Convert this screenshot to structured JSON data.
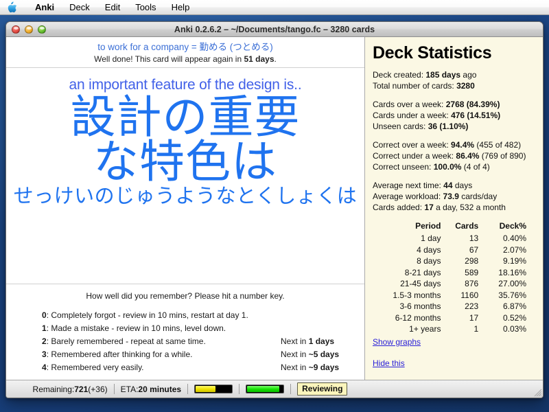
{
  "menubar": {
    "apple_icon": "apple-logo-icon",
    "items": [
      {
        "label": "Anki",
        "bold": true
      },
      {
        "label": "Deck",
        "bold": false
      },
      {
        "label": "Edit",
        "bold": false
      },
      {
        "label": "Tools",
        "bold": false
      },
      {
        "label": "Help",
        "bold": false
      }
    ]
  },
  "window": {
    "title": "Anki 0.2.6.2 – ~/Documents/tango.fc – 3280 cards",
    "controls": {
      "close": "close-button",
      "minimize": "minimize-button",
      "zoom": "zoom-button"
    }
  },
  "card": {
    "previous_answer": "to work for a company = 勤める (つとめる)",
    "interval_prefix": "Well done! This card will appear again in ",
    "interval_value": "51 days",
    "interval_suffix": ".",
    "question_english": "an important feature of the design is..",
    "question_kanji_line1": "設計の重要",
    "question_kanji_line2": "な特色は",
    "question_kana": "せっけいのじゅうようなとくしょくは"
  },
  "grading": {
    "prompt": "How well did you remember? Please hit a number key.",
    "options": [
      {
        "key": "0",
        "text": ": Completely forgot - review in 10 mins, restart at day 1.",
        "next_prefix": "",
        "next_value": ""
      },
      {
        "key": "1",
        "text": ": Made a mistake - review in 10 mins, level down.",
        "next_prefix": "",
        "next_value": ""
      },
      {
        "key": "2",
        "text": ": Barely remembered - repeat at same time.",
        "next_prefix": "Next in ",
        "next_value": "1 days"
      },
      {
        "key": "3",
        "text": ": Remembered after thinking for a while.",
        "next_prefix": "Next in ",
        "next_value": "~5 days"
      },
      {
        "key": "4",
        "text": ": Remembered very easily.",
        "next_prefix": "Next in ",
        "next_value": "~9 days"
      }
    ]
  },
  "stats": {
    "title": "Deck Statistics",
    "group1": [
      {
        "label": "Deck created: ",
        "value": "185 days",
        "suffix": " ago"
      },
      {
        "label": "Total number of cards: ",
        "value": "3280",
        "suffix": ""
      }
    ],
    "group2": [
      {
        "label": "Cards over a week: ",
        "value": "2768 (84.39%)",
        "suffix": ""
      },
      {
        "label": "Cards under a week: ",
        "value": "476 (14.51%)",
        "suffix": ""
      },
      {
        "label": "Unseen cards: ",
        "value": "36 (1.10%)",
        "suffix": ""
      }
    ],
    "group3": [
      {
        "label": "Correct over a week: ",
        "value": "94.4%",
        "suffix": " (455 of 482)"
      },
      {
        "label": "Correct under a week: ",
        "value": "86.4%",
        "suffix": " (769 of 890)"
      },
      {
        "label": "Correct unseen: ",
        "value": "100.0%",
        "suffix": " (4 of 4)"
      }
    ],
    "group4": [
      {
        "label": "Average next time: ",
        "value": "44",
        "suffix": " days"
      },
      {
        "label": "Average workload: ",
        "value": "73.9",
        "suffix": " cards/day"
      },
      {
        "label": "Cards added: ",
        "value": "17",
        "suffix": " a day, 532 a month"
      }
    ],
    "table": {
      "headers": [
        "Period",
        "Cards",
        "Deck%"
      ],
      "rows": [
        [
          "1 day",
          "13",
          "0.40%"
        ],
        [
          "4 days",
          "67",
          "2.07%"
        ],
        [
          "8 days",
          "298",
          "9.19%"
        ],
        [
          "8-21 days",
          "589",
          "18.16%"
        ],
        [
          "21-45 days",
          "876",
          "27.00%"
        ],
        [
          "1.5-3 months",
          "1160",
          "35.76%"
        ],
        [
          "3-6 months",
          "223",
          "6.87%"
        ],
        [
          "6-12 months",
          "17",
          "0.52%"
        ],
        [
          "1+ years",
          "1",
          "0.03%"
        ]
      ]
    },
    "links": {
      "show_graphs": "Show graphs",
      "hide_this": "Hide this"
    }
  },
  "statusbar": {
    "remaining_label": "Remaining: ",
    "remaining_value": "721",
    "remaining_extra": " (+36)",
    "eta_label": "ETA: ",
    "eta_value": "20 minutes",
    "progress_yellow_pct": 55,
    "progress_green_pct": 90,
    "state_badge": "Reviewing"
  },
  "colors": {
    "card_blue": "#1f73ef",
    "english_blue": "#4261e8",
    "answer_blue": "#3b6fd6",
    "stats_bg": "#fbf8e4",
    "link_blue": "#2a20d8",
    "badge_bg": "#fbf5bc",
    "desktop_blue": "#1d4c8c"
  }
}
